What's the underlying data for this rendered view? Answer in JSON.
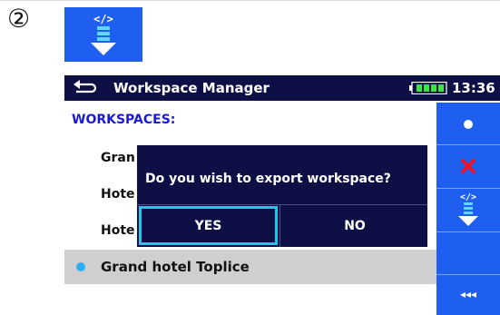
{
  "step_marker": "②",
  "colors": {
    "accent_blue": "#1f5ff0",
    "titlebar_navy": "#0e0f44",
    "heading_blue": "#1a1ad6",
    "highlight_cyan": "#1ec8e6",
    "selected_row_gray": "#cfcfcf"
  },
  "export_tile": {
    "icon": "export-arrow-icon"
  },
  "titlebar": {
    "back_icon": "back-arrow-icon",
    "title": "Workspace Manager",
    "battery_icon": "battery-icon",
    "time": "13:36"
  },
  "main": {
    "heading": "WORKSPACES:",
    "items": [
      {
        "label": "Gran"
      },
      {
        "label": "Hote"
      },
      {
        "label": "Hote"
      }
    ],
    "selected_item": {
      "label": "Grand hotel Toplice"
    }
  },
  "sidebar": {
    "buttons": [
      {
        "name": "select-dot",
        "icon": "dot-icon"
      },
      {
        "name": "delete",
        "icon": "red-x-icon"
      },
      {
        "name": "export",
        "icon": "export-arrow-icon"
      },
      {
        "name": "empty"
      },
      {
        "name": "more",
        "label": "◂◂◂"
      }
    ]
  },
  "dialog": {
    "message": "Do you wish to export workspace?",
    "yes_label": "YES",
    "no_label": "NO"
  }
}
